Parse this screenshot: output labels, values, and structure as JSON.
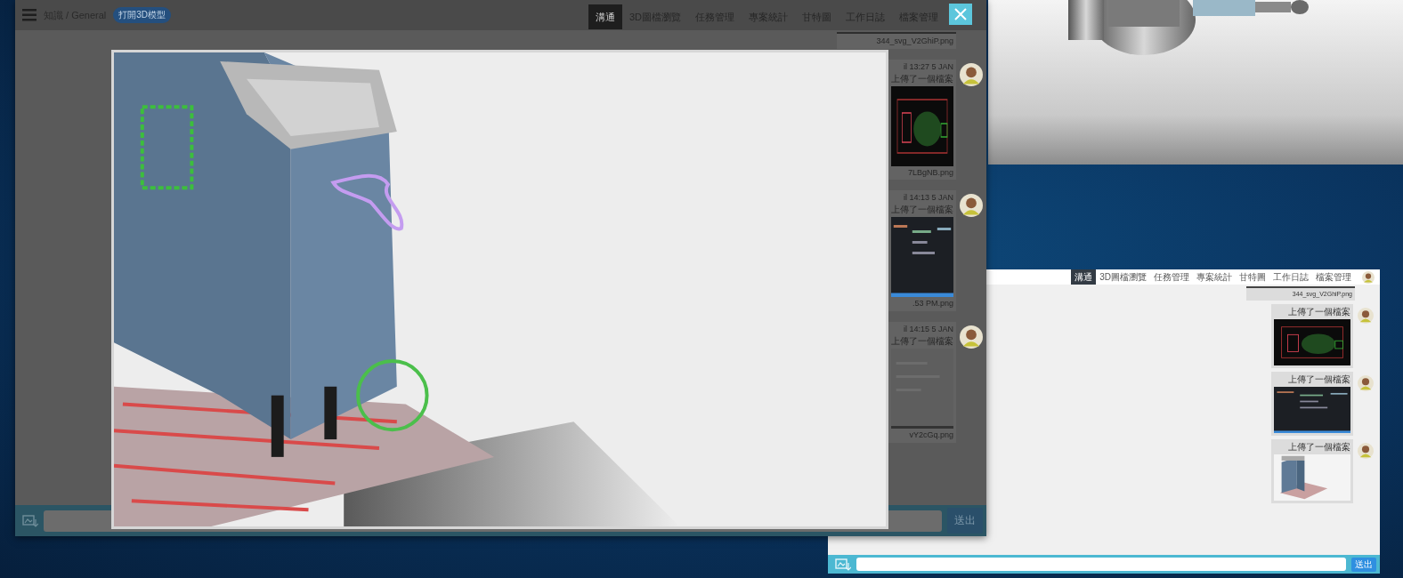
{
  "main_window": {
    "breadcrumb": "知識 / General",
    "badge": "打開3D模型",
    "tabs": [
      {
        "label": "溝通",
        "selected": true
      },
      {
        "label": "3D圖檔瀏覽",
        "selected": false
      },
      {
        "label": "任務管理",
        "selected": false
      },
      {
        "label": "專案統計",
        "selected": false
      },
      {
        "label": "甘特圖",
        "selected": false
      },
      {
        "label": "工作日誌",
        "selected": false
      },
      {
        "label": "檔案管理",
        "selected": false
      }
    ],
    "messages": [
      {
        "kind": "tail",
        "file": "344_svg_V2GhiP.png"
      },
      {
        "kind": "upload",
        "time": "il 13:27 5 JAN",
        "action": "上傳了一個檔案",
        "file": "7LBgNB.png"
      },
      {
        "kind": "upload",
        "time": "il 14:13 5 JAN",
        "action": "上傳了一個檔案",
        "file": ".53 PM.png"
      },
      {
        "kind": "upload",
        "time": "il 14:15 5 JAN",
        "action": "上傳了一個檔案",
        "file": "vY2cGq.png"
      }
    ],
    "send": "送出"
  },
  "small_window": {
    "tabs": [
      {
        "label": "溝通",
        "selected": true
      },
      {
        "label": "3D圖檔瀏覽",
        "selected": false
      },
      {
        "label": "任務管理",
        "selected": false
      },
      {
        "label": "專案統計",
        "selected": false
      },
      {
        "label": "甘特圖",
        "selected": false
      },
      {
        "label": "工作日誌",
        "selected": false
      },
      {
        "label": "檔案管理",
        "selected": false
      }
    ],
    "messages": [
      {
        "kind": "tail",
        "file": "344_svg_V2GhiP.png"
      },
      {
        "kind": "upload",
        "action": "上傳了一個檔案"
      },
      {
        "kind": "upload",
        "action": "上傳了一個檔案"
      },
      {
        "kind": "upload",
        "action": "上傳了一個檔案"
      }
    ],
    "send": "送出"
  }
}
